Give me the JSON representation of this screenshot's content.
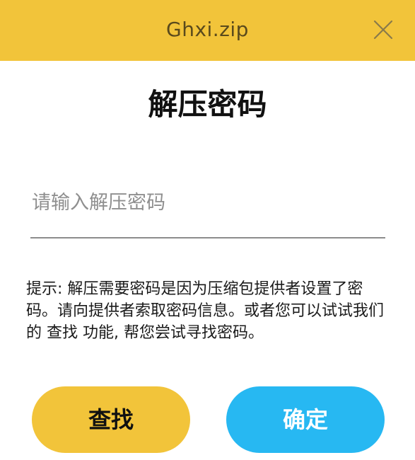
{
  "header": {
    "title": "Ghxi.zip",
    "color": "#F2C43A"
  },
  "close_icon": "close-icon",
  "dialog": {
    "title": "解压密码"
  },
  "password_field": {
    "placeholder": "请输入解压密码",
    "value": ""
  },
  "hint": {
    "prefix": "提示: 解压需要密码是因为压缩包提供者设置了密码。请向提供者索取密码信息。或者您可以试试我们的",
    "link": "查找",
    "suffix": "功能, 帮您尝试寻找密码。"
  },
  "buttons": {
    "search_label": "查找",
    "search_color": "#F2C43A",
    "confirm_label": "确定",
    "confirm_color": "#27B8F2"
  }
}
